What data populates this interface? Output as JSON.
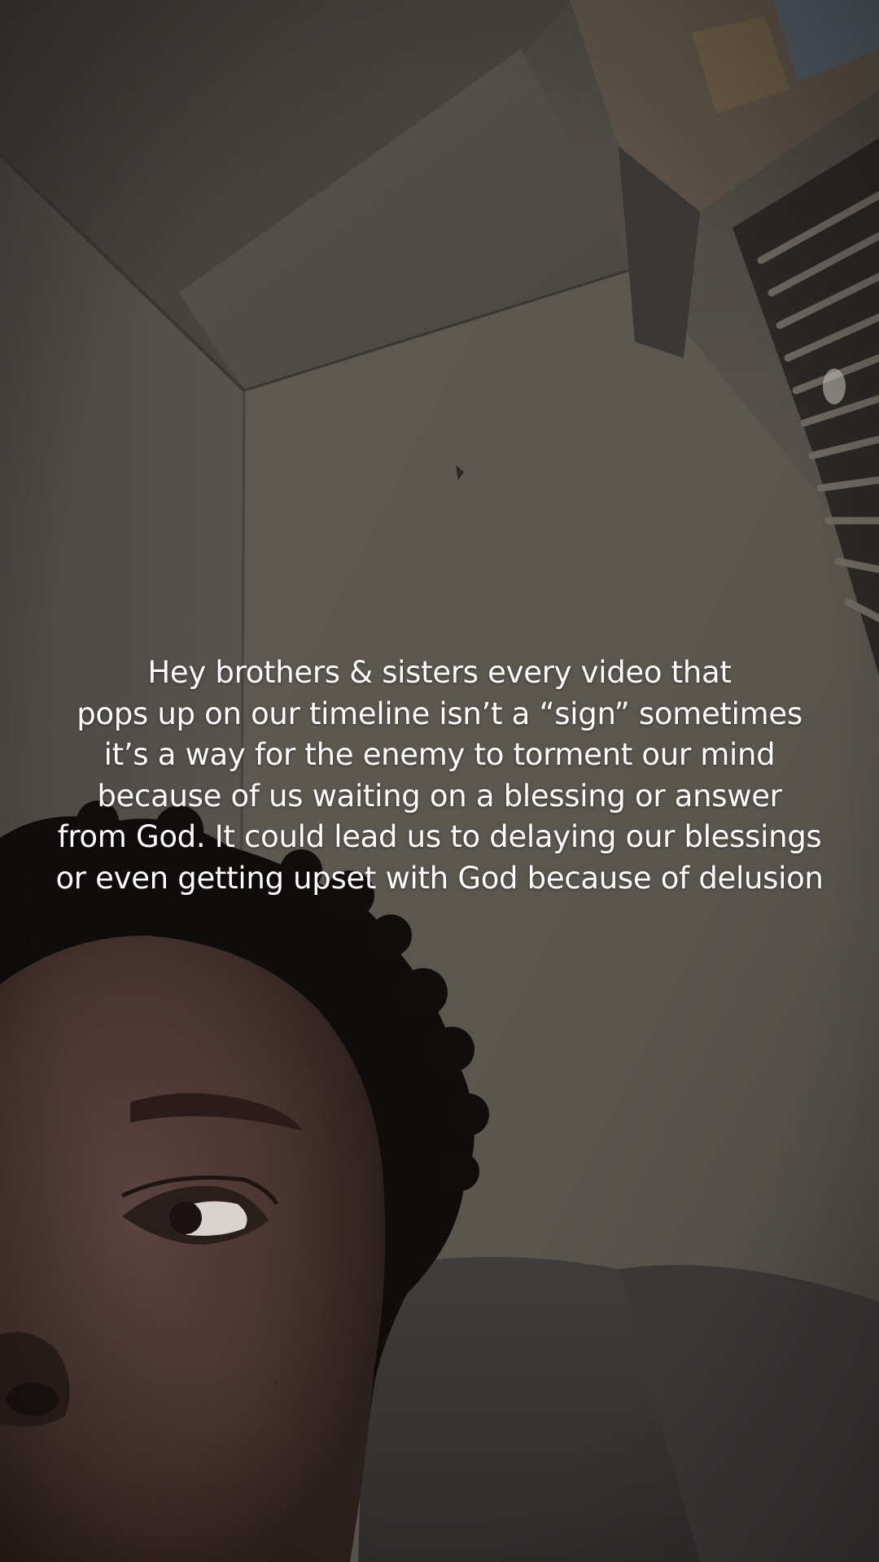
{
  "video": {
    "caption_lines": [
      "Hey brothers & sisters every video that",
      "pops up on our timeline isn’t a “sign” sometimes",
      "it’s a way for the enemy to torment our mind",
      "because of us waiting on a blessing or answer",
      "from God. It could lead us to delaying our blessings",
      "or even getting upset with God because of delusion"
    ]
  },
  "colors": {
    "caption_text": "#ffffff",
    "wall": "#5c5850",
    "ceiling": "#4e4a44",
    "hair": "#0f0c0b",
    "skin": "#4a3633"
  }
}
